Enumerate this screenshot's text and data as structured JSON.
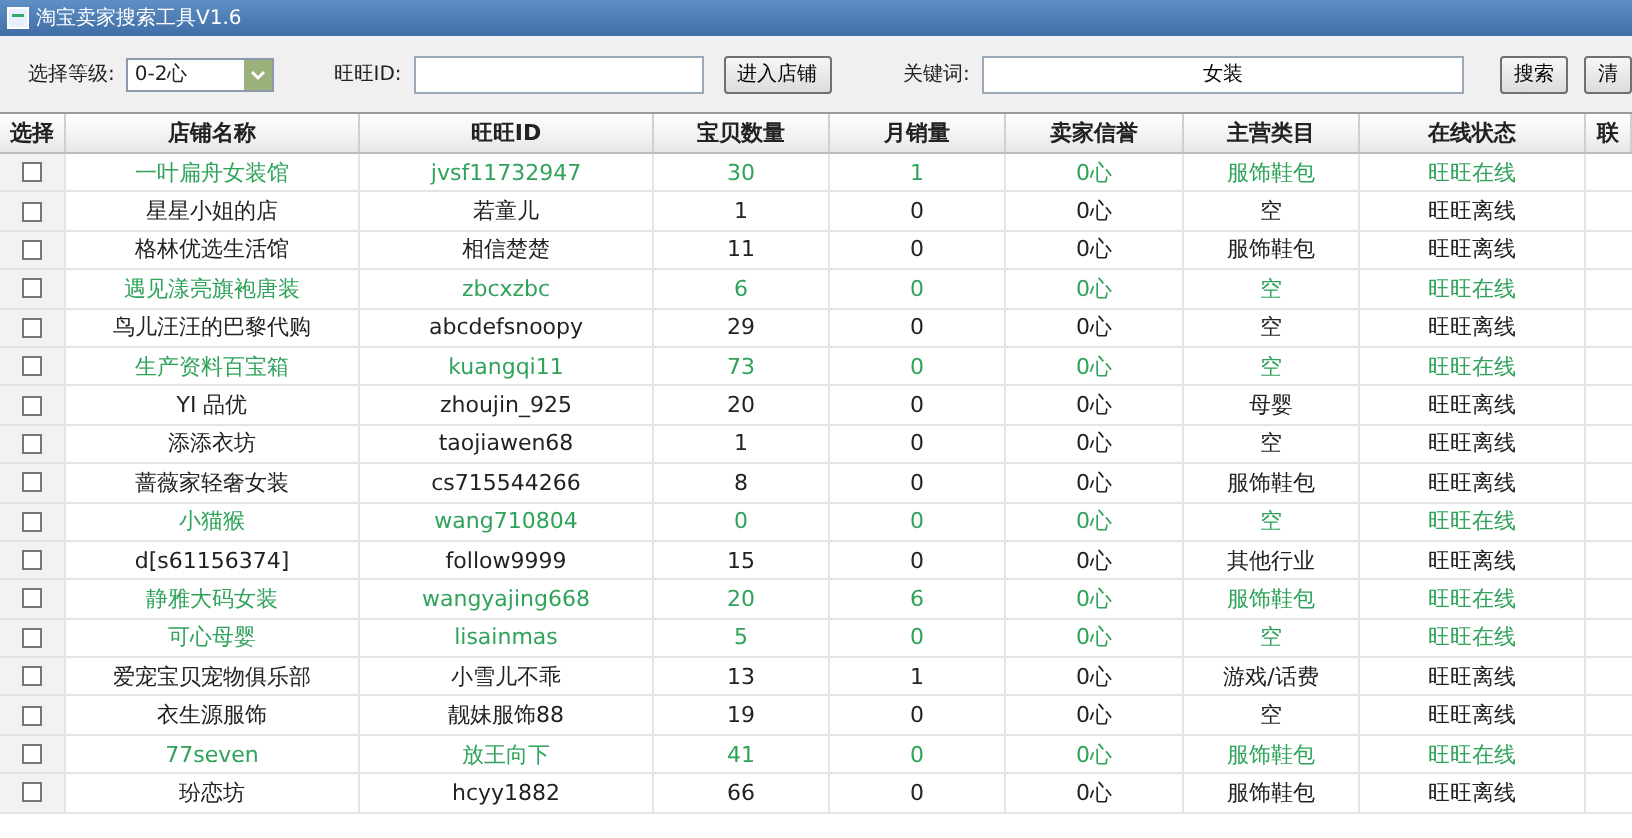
{
  "window": {
    "title": "淘宝卖家搜索工具V1.6"
  },
  "toolbar": {
    "level_label": "选择等级:",
    "level_value": "0-2心",
    "wangwang_label": "旺旺ID:",
    "enter_button": "进入店铺",
    "keyword_label": "关键词:",
    "keyword_value": "女装",
    "search_button": "搜索",
    "clear_button": "清"
  },
  "table": {
    "check_column": "选择",
    "columns": [
      "店铺名称",
      "旺旺ID",
      "宝贝数量",
      "月销量",
      "卖家信誉",
      "主营类目",
      "在线状态"
    ],
    "cut_column": "联",
    "rows": [
      {
        "checked": false,
        "online": true,
        "cells": [
          "一叶扁舟女装馆",
          "jvsf11732947",
          "30",
          "1",
          "0心",
          "服饰鞋包",
          "旺旺在线"
        ]
      },
      {
        "checked": false,
        "online": false,
        "cells": [
          "星星小姐的店",
          "若童儿",
          "1",
          "0",
          "0心",
          "空",
          "旺旺离线"
        ]
      },
      {
        "checked": false,
        "online": false,
        "cells": [
          "格林优选生活馆",
          "相信楚楚",
          "11",
          "0",
          "0心",
          "服饰鞋包",
          "旺旺离线"
        ]
      },
      {
        "checked": false,
        "online": true,
        "cells": [
          "遇见漾亮旗袍唐装",
          "zbcxzbc",
          "6",
          "0",
          "0心",
          "空",
          "旺旺在线"
        ]
      },
      {
        "checked": false,
        "online": false,
        "cells": [
          "鸟儿汪汪的巴黎代购",
          "abcdefsnoopy",
          "29",
          "0",
          "0心",
          "空",
          "旺旺离线"
        ]
      },
      {
        "checked": false,
        "online": true,
        "cells": [
          "生产资料百宝箱",
          "kuangqi11",
          "73",
          "0",
          "0心",
          "空",
          "旺旺在线"
        ]
      },
      {
        "checked": false,
        "online": false,
        "cells": [
          "YI 品优",
          "zhoujin_925",
          "20",
          "0",
          "0心",
          "母婴",
          "旺旺离线"
        ]
      },
      {
        "checked": false,
        "online": false,
        "cells": [
          "添添衣坊",
          "taojiawen68",
          "1",
          "0",
          "0心",
          "空",
          "旺旺离线"
        ]
      },
      {
        "checked": false,
        "online": false,
        "cells": [
          "蔷薇家轻奢女装",
          "cs715544266",
          "8",
          "0",
          "0心",
          "服饰鞋包",
          "旺旺离线"
        ]
      },
      {
        "checked": false,
        "online": true,
        "cells": [
          "小猫猴",
          "wang710804",
          "0",
          "0",
          "0心",
          "空",
          "旺旺在线"
        ]
      },
      {
        "checked": false,
        "online": false,
        "cells": [
          "d[s61156374]",
          "follow9999",
          "15",
          "0",
          "0心",
          "其他行业",
          "旺旺离线"
        ]
      },
      {
        "checked": false,
        "online": true,
        "cells": [
          "静雅大码女装",
          "wangyajing668",
          "20",
          "6",
          "0心",
          "服饰鞋包",
          "旺旺在线"
        ]
      },
      {
        "checked": false,
        "online": true,
        "cells": [
          "可心母婴",
          "lisainmas",
          "5",
          "0",
          "0心",
          "空",
          "旺旺在线"
        ]
      },
      {
        "checked": false,
        "online": false,
        "cells": [
          "爱宠宝贝宠物俱乐部",
          "小雪儿不乖",
          "13",
          "1",
          "0心",
          "游戏/话费",
          "旺旺离线"
        ]
      },
      {
        "checked": false,
        "online": false,
        "cells": [
          "衣生源服饰",
          "靓妹服饰88",
          "19",
          "0",
          "0心",
          "空",
          "旺旺离线"
        ]
      },
      {
        "checked": false,
        "online": true,
        "cells": [
          "77seven",
          "放王向下",
          "41",
          "0",
          "0心",
          "服饰鞋包",
          "旺旺在线"
        ]
      },
      {
        "checked": false,
        "online": false,
        "cells": [
          "玢恋坊",
          "hcyy1882",
          "66",
          "0",
          "0心",
          "服饰鞋包",
          "旺旺离线"
        ]
      }
    ]
  }
}
